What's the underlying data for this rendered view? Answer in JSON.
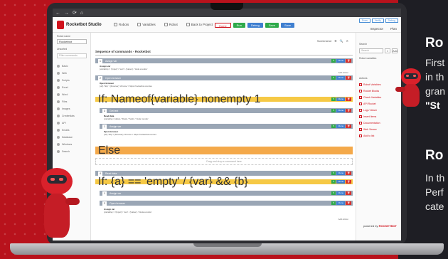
{
  "browser": {
    "nav_icons": [
      "←",
      "→",
      "⟳",
      "⌂"
    ]
  },
  "app": {
    "logo_text": "Rocketbot Studio",
    "nav": [
      "Robots",
      "Variables",
      "Robot",
      "Back to Project"
    ],
    "header_buttons": [
      {
        "label": "Home",
        "color": "#ffffff"
      },
      {
        "label": "Run",
        "color": "#2eaa4a"
      },
      {
        "label": "Debug",
        "color": "#3f7fd0"
      },
      {
        "label": "Save",
        "color": "#2eaa4a"
      },
      {
        "label": "Save",
        "color": "#3f7fd0"
      }
    ],
    "top_right": [
      "Docs",
      "Verify",
      "Debug"
    ],
    "inspector": [
      "Inspector",
      "Plan"
    ]
  },
  "sidebar": {
    "robot_name_label": "Robot name",
    "robot_select_value": "Rocketbot",
    "checkbox_label": "Unsorted",
    "filter_placeholder": "Filter commands",
    "items": [
      "Basic",
      "Web",
      "Scripts",
      "Excel",
      "Word",
      "Files",
      "Images",
      "Credentials",
      "API",
      "Emails",
      "Database",
      "Windows",
      "Search"
    ]
  },
  "main": {
    "toolbar": [
      "Screenshot",
      "⚙",
      "🔍",
      "✕"
    ],
    "title": "Sequence of commands - Rocketbot",
    "drag_hint": "Drag and drop a command here",
    "add_action": "Add Action",
    "row_actions": {
      "edit": "✎",
      "clone": "Clone",
      "delete": "🗑"
    },
    "rows": [
      {
        "num": "1",
        "label": "Assign var"
      },
      {
        "num": "2",
        "label": "Open browser"
      },
      {
        "num": "3",
        "label": "Get text"
      },
      {
        "num": "1",
        "label": "Assign var"
      },
      {
        "num": "2",
        "label": "Open browser"
      },
      {
        "num": "4",
        "label": "Read data"
      },
      {
        "num": "1",
        "label": "Assign var"
      },
      {
        "num": "2",
        "label": "Open browser"
      }
    ],
    "condition_1": "If: Nameof{variable} nonempty 1",
    "condition_2": "If: {a} == 'empty' / {var} && {b}",
    "else_label": "Else",
    "detail_lines": [
      "Assign var",
      "{variable} = '{input}' / 'text' / {'value'} / 'Hola a todos'",
      "Open browser",
      "{url} 'http' / {browser} 'chrome' / https://rocketbot.com/es",
      "Read data",
      "{variable} / {data} / 'Data' / 'hello' / 'Hola mundo'"
    ]
  },
  "right_panel": {
    "search_label": "Search",
    "search_placeholder": "Search",
    "search_btn": "⌕",
    "robot_var_label": "Robot variables",
    "add_label": "Add",
    "actions_label": "Actions",
    "items": [
      "Robot Variables",
      "Rocket Blocks",
      "Check Variables",
      "API Rocket",
      "Logs Viewer",
      "Insert Items",
      "Documentation",
      "Web Viewer",
      "Add to list"
    ],
    "footer_pre": "powered by",
    "footer_brand": "ROCKETBOT"
  },
  "side_copy": {
    "heading_1": "Ro",
    "lines_1": [
      "First",
      "in th",
      "gran",
      "\"St"
    ],
    "heading_2": "Ro",
    "lines_2": [
      "In th",
      "Perf",
      "cate"
    ]
  }
}
